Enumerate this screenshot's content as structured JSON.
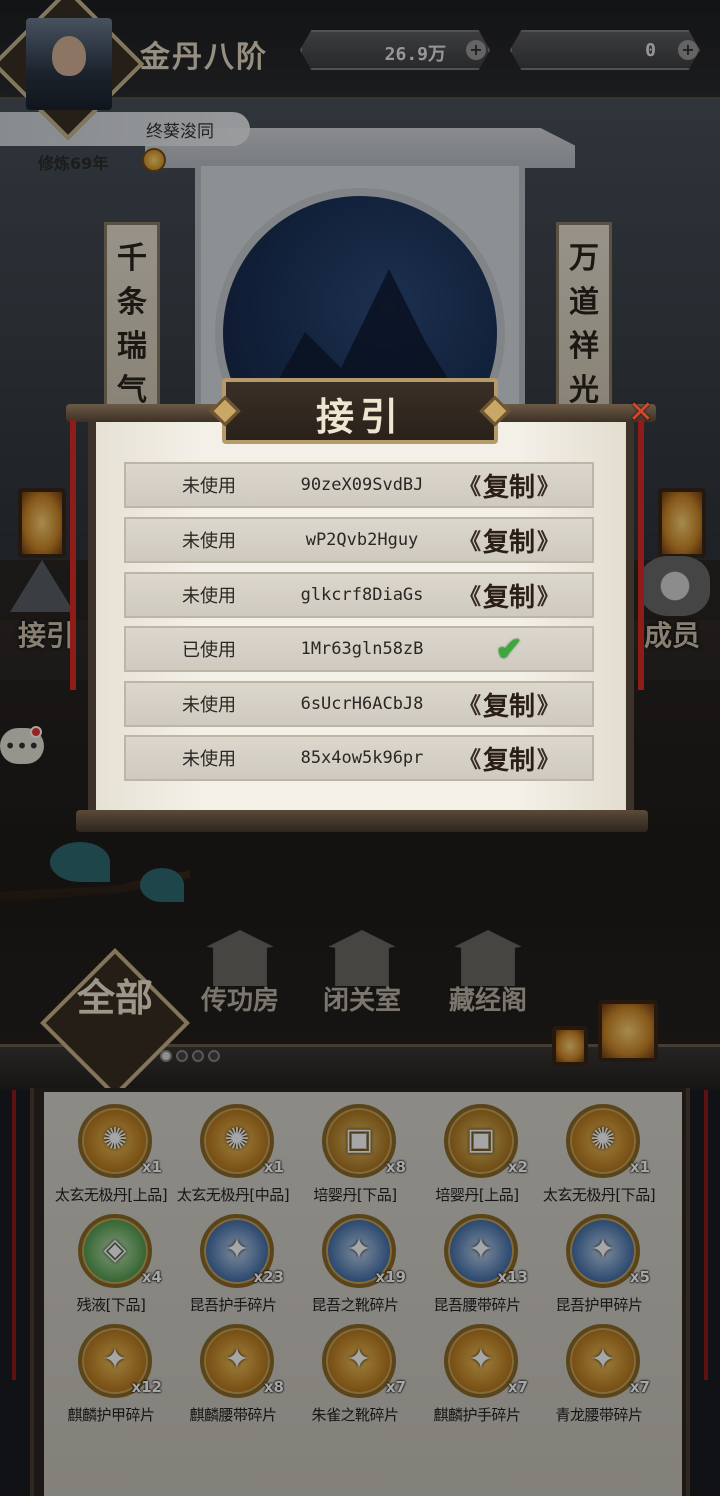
{
  "header": {
    "realm": "金丹八阶",
    "resources": [
      {
        "icon": "spirit-stone-icon",
        "value": "26.9万"
      },
      {
        "icon": "jade-icon",
        "value": "0"
      }
    ],
    "player_name": "终葵浚同",
    "cultivation": "修炼69年"
  },
  "scene": {
    "couplet_left": "千条瑞气贯",
    "couplet_right": "万道祥光归",
    "side_left_label": "接引",
    "side_right_label": "成员"
  },
  "modal": {
    "title": "接引",
    "close_icon": "close-x-icon",
    "codes": [
      {
        "status": "未使用",
        "code": "90zeX09SvdBJ",
        "action": "复制",
        "used": false
      },
      {
        "status": "未使用",
        "code": "wP2Qvb2Hguy",
        "action": "复制",
        "used": false
      },
      {
        "status": "未使用",
        "code": "glkcrf8DiaGs",
        "action": "复制",
        "used": false
      },
      {
        "status": "已使用",
        "code": "1Mr63gln58zB",
        "action": "",
        "used": true
      },
      {
        "status": "未使用",
        "code": "6sUcrH6ACbJ8",
        "action": "复制",
        "used": false
      },
      {
        "status": "未使用",
        "code": "85x4ow5k96pr",
        "action": "复制",
        "used": false
      }
    ]
  },
  "bottom": {
    "all_label": "全部",
    "buildings": [
      "传功房",
      "闭关室",
      "藏经阁"
    ],
    "pager_active": 0,
    "pager_count": 4
  },
  "items": [
    {
      "name": "太玄无极丹[上品]",
      "count": "x1",
      "style": "gold",
      "glyph": "✺"
    },
    {
      "name": "太玄无极丹[中品]",
      "count": "x1",
      "style": "gold",
      "glyph": "✺"
    },
    {
      "name": "培婴丹[下品]",
      "count": "x8",
      "style": "purple",
      "glyph": "▣"
    },
    {
      "name": "培婴丹[上品]",
      "count": "x2",
      "style": "purple",
      "glyph": "▣"
    },
    {
      "name": "太玄无极丹[下品]",
      "count": "x1",
      "style": "gold",
      "glyph": "✺"
    },
    {
      "name": "残液[下品]",
      "count": "x4",
      "style": "green",
      "glyph": "◈"
    },
    {
      "name": "昆吾护手碎片",
      "count": "x23",
      "style": "blue",
      "glyph": "✦"
    },
    {
      "name": "昆吾之靴碎片",
      "count": "x19",
      "style": "blue",
      "glyph": "✦"
    },
    {
      "name": "昆吾腰带碎片",
      "count": "x13",
      "style": "blue",
      "glyph": "✦"
    },
    {
      "name": "昆吾护甲碎片",
      "count": "x5",
      "style": "blue",
      "glyph": "✦"
    },
    {
      "name": "麒麟护甲碎片",
      "count": "x12",
      "style": "gold",
      "glyph": "✦"
    },
    {
      "name": "麒麟腰带碎片",
      "count": "x8",
      "style": "gold",
      "glyph": "✦"
    },
    {
      "name": "朱雀之靴碎片",
      "count": "x7",
      "style": "gold",
      "glyph": "✦"
    },
    {
      "name": "麒麟护手碎片",
      "count": "x7",
      "style": "gold",
      "glyph": "✦"
    },
    {
      "name": "青龙腰带碎片",
      "count": "x7",
      "style": "gold",
      "glyph": "✦"
    }
  ]
}
